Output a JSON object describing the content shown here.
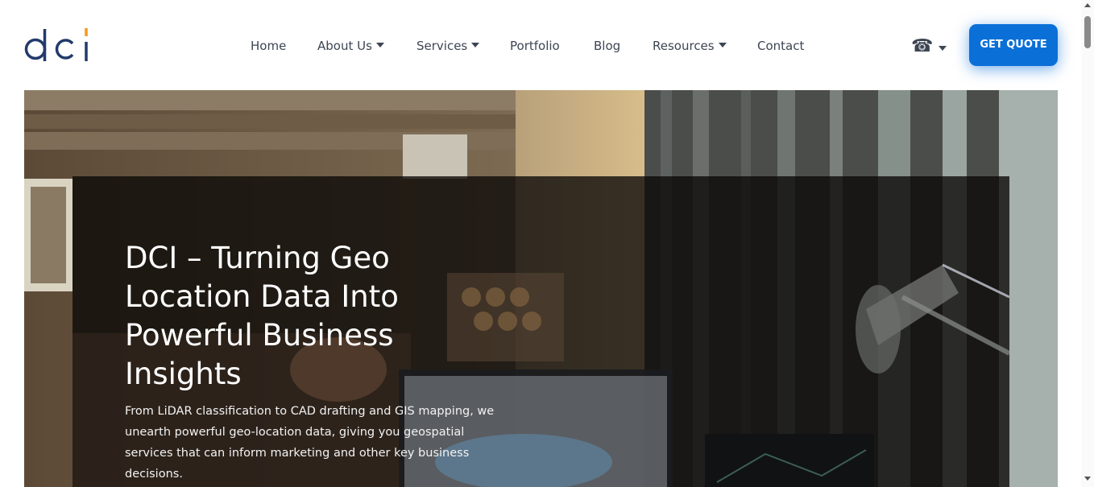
{
  "header": {
    "logo_text": "dci",
    "nav": [
      {
        "label": "Home",
        "dropdown": false
      },
      {
        "label": "About Us",
        "dropdown": true
      },
      {
        "label": "Services",
        "dropdown": true
      },
      {
        "label": "Portfolio",
        "dropdown": false
      },
      {
        "label": "Blog",
        "dropdown": false
      },
      {
        "label": "Resources",
        "dropdown": true
      },
      {
        "label": "Contact",
        "dropdown": false
      }
    ],
    "phone_icon": "phone-icon",
    "quote_button": "GET QUOTE"
  },
  "hero": {
    "title": "DCI – Turning Geo Location Data Into Powerful Business Insights",
    "description": "From LiDAR classification to CAD drafting and GIS mapping, we unearth powerful geo-location data, giving you geospatial services that can inform marketing and other key business decisions."
  },
  "colors": {
    "brand_navy": "#223a6b",
    "brand_orange": "#f39c1b",
    "button_blue": "#0b6fd8",
    "nav_text": "#3d4553"
  }
}
